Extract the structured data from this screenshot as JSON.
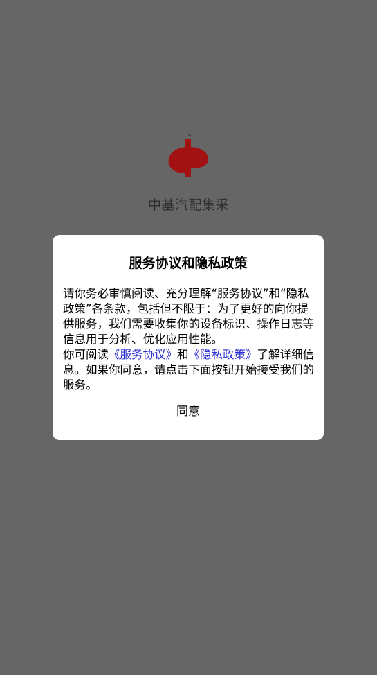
{
  "app": {
    "name": "中基汽配集采",
    "logo_icon": "zhongji-logo-icon",
    "logo_color": "#a31212"
  },
  "dialog": {
    "title": "服务协议和隐私政策",
    "body_part1": "请你务必审慎阅读、充分理解“服务协议”和“隐私政策”各条款，包括但不限于：为了更好的向你提供服务，我们需要收集你的设备标识、操作日志等信息用于分析、优化应用性能。",
    "body_part2_prefix": "你可阅读",
    "service_link": "《服务协议》",
    "and_text": "和",
    "privacy_link": "《隐私政策》",
    "body_part2_suffix": "了解详细信息。如果你同意，请点击下面按钮开始接受我们的服务。",
    "link_color": "#2a2fd1",
    "agree_label": "同意"
  },
  "colors": {
    "overlay": "#666666",
    "dialog_bg": "#ffffff"
  }
}
